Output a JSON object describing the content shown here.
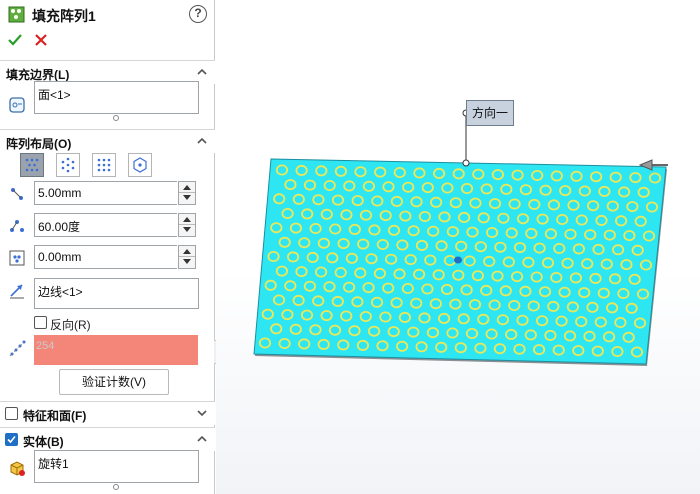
{
  "panel": {
    "title": "填充阵列1",
    "help": "?"
  },
  "sections": {
    "fill_boundary": {
      "title": "填充边界(L)",
      "value": "面<1>"
    },
    "pattern_layout": {
      "title": "阵列布局(O)",
      "spacing": "5.00mm",
      "angle": "60.00度",
      "margin": "0.00mm",
      "direction": "边线<1>",
      "reverse_label": "反向(R)",
      "instance_count": "254",
      "verify_label": "验证计数(V)"
    },
    "features_faces": {
      "title": "特征和面(F)",
      "checked": false
    },
    "bodies": {
      "title": "实体(B)",
      "checked": true,
      "value": "旋转1"
    }
  },
  "viewport": {
    "direction_callout": "方向一"
  },
  "colors": {
    "plate_fill": "#2ee6f2",
    "ring_color": "#e9e85a",
    "count_error_bg": "#f48679",
    "accent_blue": "#1f6fc6"
  }
}
